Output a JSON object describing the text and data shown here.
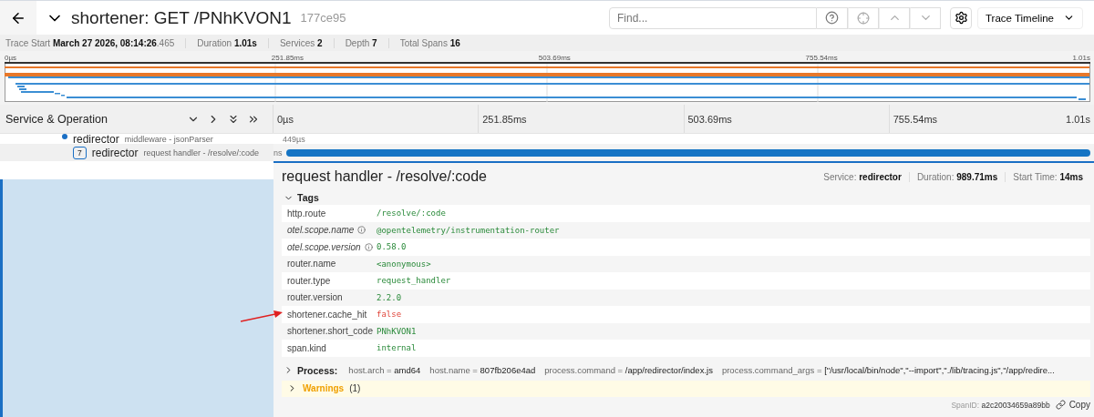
{
  "header": {
    "title": "shortener: GET /PNhKVON1",
    "trace_id": "177ce95",
    "search": {
      "placeholder": "Find..."
    },
    "view_menu": "Trace Timeline"
  },
  "meta": [
    {
      "label": "Trace Start",
      "value": "March 27 2026, 08:14:26",
      "suffix": ".465"
    },
    {
      "label": "Duration",
      "value": "1.01s"
    },
    {
      "label": "Services",
      "value": "2"
    },
    {
      "label": "Depth",
      "value": "7"
    },
    {
      "label": "Total Spans",
      "value": "16"
    }
  ],
  "minimap": {
    "ticks": [
      "0µs",
      "251.85ms",
      "503.69ms",
      "755.54ms",
      "1.01s"
    ]
  },
  "timeline": {
    "column_title": "Service & Operation",
    "ticks": [
      "0µs",
      "251.85ms",
      "503.69ms",
      "755.54ms",
      "1.01s"
    ],
    "spans": [
      {
        "service": "redirector",
        "operation": "middleware - jsonParser",
        "duration": "449µs",
        "selected": false
      },
      {
        "service": "redirector",
        "operation": "request handler - /resolve/:code",
        "duration": "ns",
        "badge": "7",
        "selected": true
      }
    ]
  },
  "detail": {
    "title": "request handler - /resolve/:code",
    "info": [
      {
        "label": "Service:",
        "value": "redirector"
      },
      {
        "label": "Duration:",
        "value": "989.71ms"
      },
      {
        "label": "Start Time:",
        "value": "14ms"
      }
    ],
    "tags": {
      "title": "Tags",
      "expanded": true,
      "rows": [
        {
          "key": "http.route",
          "value": "/resolve/:code",
          "kind": "string",
          "info": false
        },
        {
          "key": "otel.scope.name",
          "value": "@opentelemetry/instrumentation-router",
          "kind": "string",
          "info": true
        },
        {
          "key": "otel.scope.version",
          "value": "0.58.0",
          "kind": "string",
          "info": true
        },
        {
          "key": "router.name",
          "value": "<anonymous>",
          "kind": "string",
          "info": false
        },
        {
          "key": "router.type",
          "value": "request_handler",
          "kind": "string",
          "info": false
        },
        {
          "key": "router.version",
          "value": "2.2.0",
          "kind": "string",
          "info": false
        },
        {
          "key": "shortener.cache_hit",
          "value": "false",
          "kind": "bool",
          "info": false
        },
        {
          "key": "shortener.short_code",
          "value": "PNhKVON1",
          "kind": "string",
          "info": false
        },
        {
          "key": "span.kind",
          "value": "internal",
          "kind": "string",
          "info": false
        }
      ]
    },
    "process": {
      "title": "Process:",
      "expanded": false,
      "separator": "=",
      "items": [
        {
          "key": "host.arch",
          "value": "amd64"
        },
        {
          "key": "host.name",
          "value": "807fb206e4ad"
        },
        {
          "key": "process.command",
          "value": "/app/redirector/index.js"
        },
        {
          "key": "process.command_args",
          "value": "[\"/usr/local/bin/node\",\"--import\",\"./lib/tracing.js\",\"/app/redire..."
        }
      ]
    },
    "warnings": {
      "title": "Warnings",
      "count": "(1)",
      "expanded": false
    },
    "span_id": {
      "label": "SpanID:",
      "value": "a2c20034659a89bb",
      "copy": "Copy"
    }
  }
}
